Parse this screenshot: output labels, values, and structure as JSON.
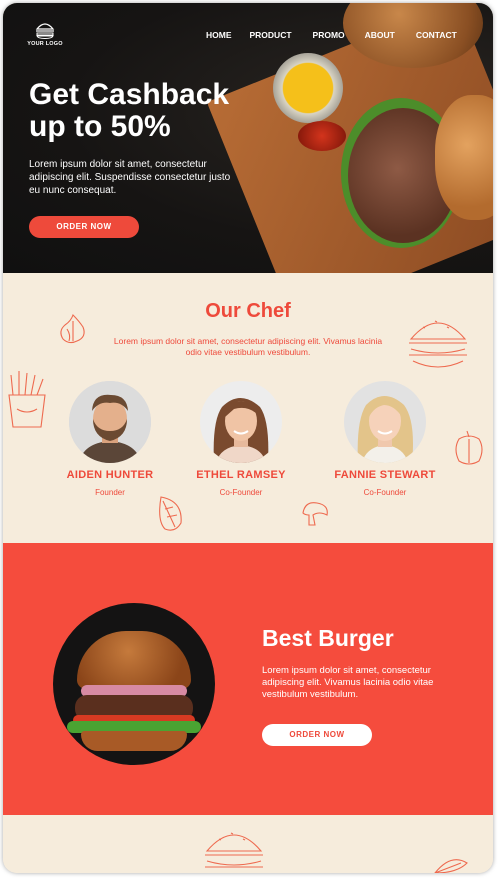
{
  "nav": {
    "logo_text": "YOUR LOGO",
    "items": [
      {
        "label": "HOME"
      },
      {
        "label": "PRODUCT"
      },
      {
        "label": "PROMO"
      },
      {
        "label": "ABOUT"
      },
      {
        "label": "CONTACT"
      }
    ]
  },
  "hero": {
    "headline_line1": "Get Cashback",
    "headline_line2": "up to 50%",
    "text": "Lorem ipsum dolor sit amet, consectetur adipiscing elit. Suspendisse consectetur justo eu nunc consequat.",
    "button": "ORDER NOW"
  },
  "chef": {
    "title": "Our Chef",
    "description": "Lorem ipsum dolor sit amet, consectetur adipiscing elit. Vivamus lacinia odio vitae vestibulum vestibulum.",
    "members": [
      {
        "name": "AIDEN HUNTER",
        "role": "Founder"
      },
      {
        "name": "ETHEL RAMSEY",
        "role": "Co-Founder"
      },
      {
        "name": "FANNIE STEWART",
        "role": "Co-Founder"
      }
    ]
  },
  "best": {
    "title": "Best Burger",
    "text": "Lorem ipsum dolor sit amet, consectetur adipiscing elit. Vivamus lacinia odio vitae vestibulum vestibulum.",
    "button": "ORDER NOW"
  },
  "colors": {
    "accent": "#ee4a3b",
    "section_red": "#f54c3d",
    "cream": "#f6ecdc",
    "dark": "#161413"
  }
}
